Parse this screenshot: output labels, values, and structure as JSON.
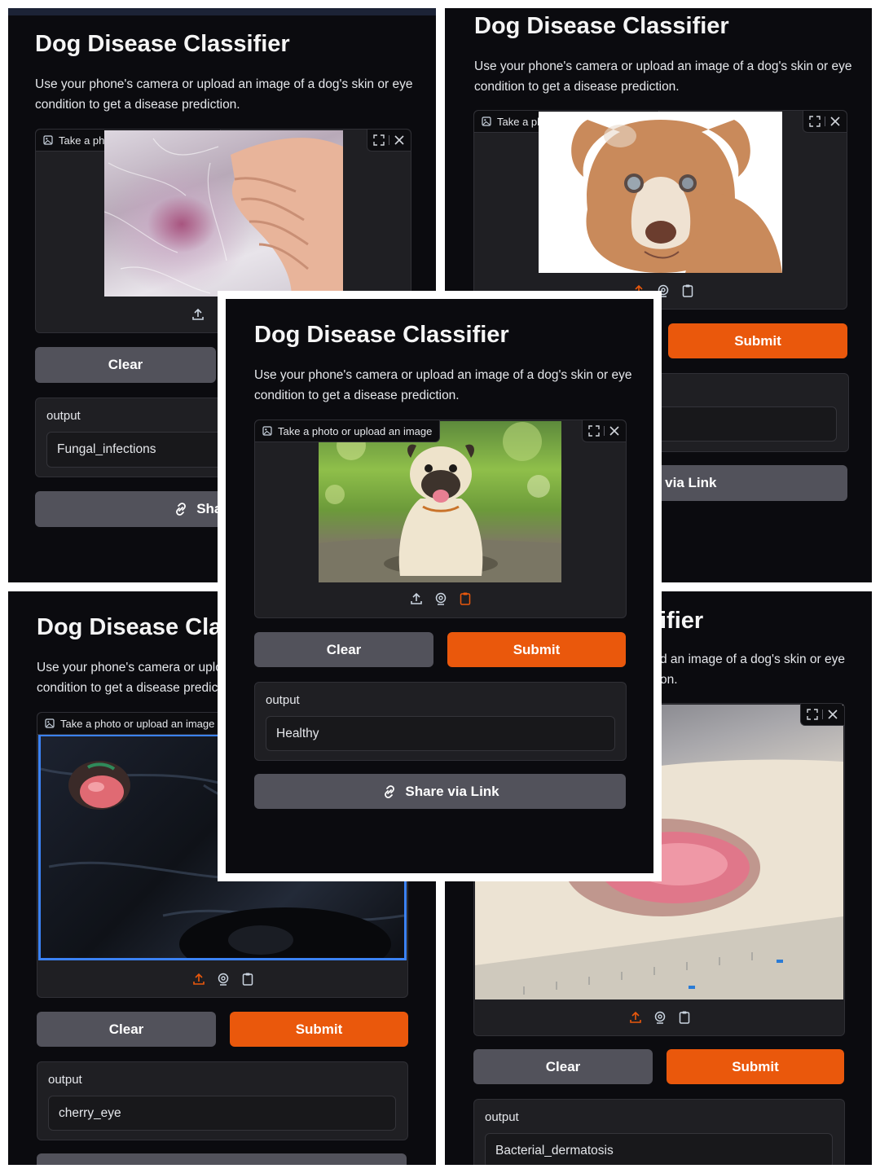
{
  "app": {
    "title": "Dog Disease Classifier",
    "description": "Use your phone's camera or upload an image of a dog's skin or eye condition to get a disease prediction.",
    "input_label": "Take a photo or upload an image",
    "clear_label": "Clear",
    "submit_label": "Submit",
    "output_label": "output",
    "share_label": "Share via Link"
  },
  "screens": {
    "top_left": {
      "prediction": "Fungal_infections",
      "partial_title": "Dog Disease Classifier",
      "partial_share": "Shar"
    },
    "top_right": {
      "share_partial": "e via Link"
    },
    "center": {
      "prediction": "Healthy"
    },
    "bottom_left": {
      "prediction": "cherry_eye",
      "partial_title": "Dog Disease Class",
      "partial_desc_1": "Use your phone's camera or uplo",
      "partial_desc_2": "condition to get a disease predict"
    },
    "bottom_right": {
      "prediction": "Bacterial_dermatosis",
      "partial_title": "ifier",
      "partial_desc_1": "d an image of a dog's skin or eye",
      "partial_desc_2": "on."
    }
  },
  "icons": [
    "image-icon",
    "fullscreen-icon",
    "close-icon",
    "upload-icon",
    "webcam-icon",
    "clipboard-icon",
    "link-icon"
  ],
  "colors": {
    "background": "#0b0b0f",
    "panel": "#1f1f23",
    "submit": "#ea580c",
    "clear": "#52525b"
  }
}
